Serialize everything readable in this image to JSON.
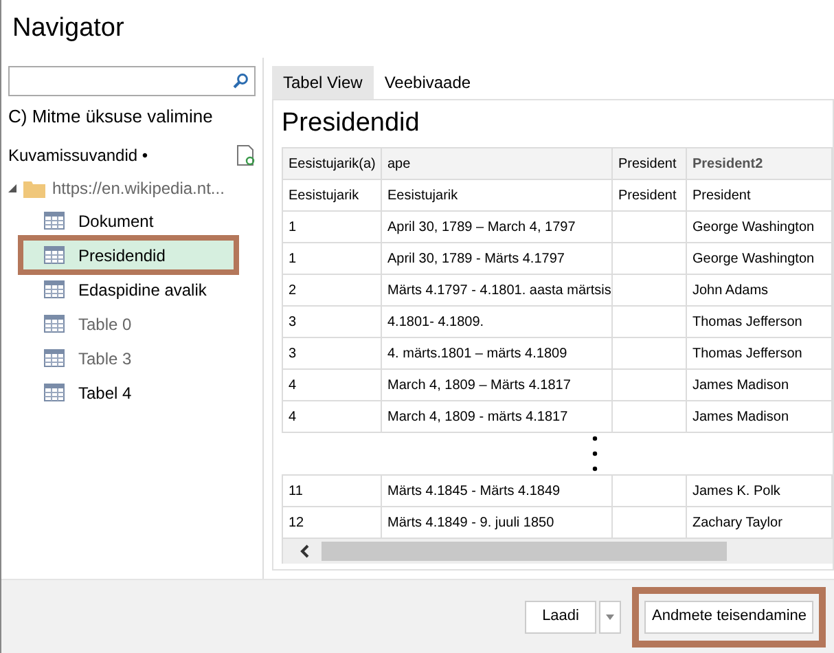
{
  "window": {
    "title": "Navigator"
  },
  "sidebar": {
    "multi_select": "C) Mitme üksuse valimine",
    "display_options": "Kuvamissuvandid •",
    "tree": [
      {
        "label": "https://en.wikipedia.nt...",
        "expanded": true,
        "children": [
          {
            "label": "Dokument",
            "selected": false,
            "outlined": false,
            "dimmed": false
          },
          {
            "label": "Presidendid",
            "selected": true,
            "outlined": true,
            "dimmed": false
          },
          {
            "label": "Edaspidine avalik",
            "selected": false,
            "outlined": false,
            "dimmed": false
          },
          {
            "label": "Table 0",
            "selected": false,
            "outlined": false,
            "dimmed": true
          },
          {
            "label": "Table 3",
            "selected": false,
            "outlined": false,
            "dimmed": true
          },
          {
            "label": "Tabel 4",
            "selected": false,
            "outlined": false,
            "dimmed": false
          }
        ]
      }
    ]
  },
  "tabs": [
    {
      "label": "Tabel View",
      "selected": true
    },
    {
      "label": "Veebivaade",
      "selected": false
    }
  ],
  "preview": {
    "title": "Presidendid",
    "table": {
      "columns": [
        "Eesistujarik(a)",
        "ape",
        "President",
        "President2"
      ],
      "rows": [
        {
          "column_1": "Eesistujarik",
          "column_2": "Eesistujarik",
          "column_3": "President",
          "column_4": "President"
        },
        {
          "column_1": "1",
          "column_2": "April 30, 1789 – March 4, 1797",
          "column_4": "George Washington"
        },
        {
          "column_1": "1",
          "column_2": "April 30, 1789 - Märts 4.1797",
          "column_4": "George Washington"
        },
        {
          "column_1": "2",
          "column_2": "Märts 4.1797 - 4.1801. aasta märtsis",
          "column_4": "John Adams"
        },
        {
          "column_1": "3",
          "column_2": "4.1801-  4.1809.",
          "column_4": "Thomas Jefferson"
        },
        {
          "column_1": "3",
          "column_2": "4. märts.1801 – märts 4.1809",
          "column_4": "Thomas Jefferson"
        },
        {
          "column_1": "4",
          "column_2": "March 4, 1809 – Märts 4.1817",
          "column_4": "James Madison"
        },
        {
          "column_1": "4",
          "column_2": "March 4, 1809 - märts 4.1817",
          "column_4": "James Madison"
        }
      ],
      "rows_after_gap": [
        {
          "column_1": "11",
          "column_2": "Märts 4.1845 - Märts 4.1849",
          "column_4": "James K. Polk"
        },
        {
          "column_1": "12",
          "column_2": "Märts 4.1849 - 9. juuli 1850",
          "column_4": "Zachary Taylor"
        }
      ]
    }
  },
  "footer": {
    "buttons": [
      {
        "label": "Laadi",
        "kind": "split",
        "outlined": false
      },
      {
        "label": "Andmete teisendamine",
        "kind": "plain",
        "outlined": true
      }
    ]
  }
}
